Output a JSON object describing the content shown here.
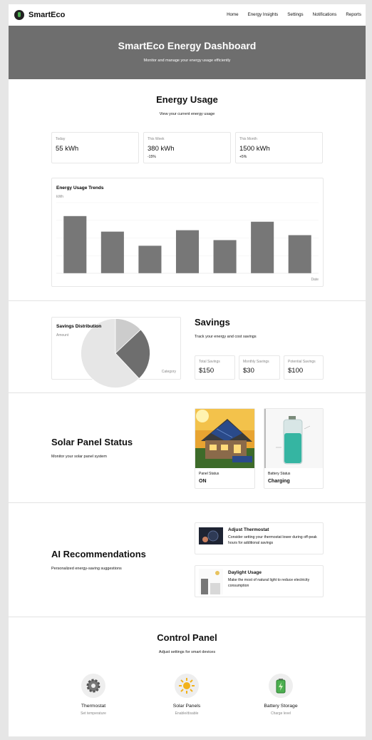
{
  "nav": {
    "brand": "SmartEco",
    "links": [
      "Home",
      "Energy Insights",
      "Settings",
      "Notifications",
      "Reports"
    ]
  },
  "hero": {
    "title": "SmartEco Energy Dashboard",
    "subtitle": "Monitor and manage your energy usage efficiently"
  },
  "usage": {
    "title": "Energy Usage",
    "subtitle": "View your current energy usage",
    "stats": [
      {
        "label": "Today",
        "value": "55 kWh",
        "change": ""
      },
      {
        "label": "This Week",
        "value": "380 kWh",
        "change": "-15%"
      },
      {
        "label": "This Month",
        "value": "1500 kWh",
        "change": "+5%"
      }
    ]
  },
  "chart_data": [
    {
      "type": "bar",
      "title": "Energy Usage Trends",
      "ylabel": "kWh",
      "xlabel": "Date",
      "ylim": [
        0,
        100
      ],
      "grid": true,
      "values": [
        81,
        59,
        39,
        61,
        47,
        73,
        54
      ]
    },
    {
      "type": "pie",
      "title": "Savings Distribution",
      "ylabel": "Amount",
      "xlabel": "Category",
      "values": [
        13,
        25,
        62
      ],
      "colors": [
        "#cccccc",
        "#6e6e6e",
        "#e6e6e6"
      ]
    }
  ],
  "savings": {
    "title": "Savings",
    "subtitle": "Track your energy and cost savings",
    "stats": [
      {
        "label": "Total Savings",
        "value": "$150"
      },
      {
        "label": "Monthly Savings",
        "value": "$30"
      },
      {
        "label": "Potential Savings",
        "value": "$100"
      }
    ]
  },
  "solar": {
    "title": "Solar Panel Status",
    "subtitle": "Monitor your solar panel system",
    "cards": [
      {
        "label": "Panel Status",
        "value": "ON",
        "image": "solar-house-photo"
      },
      {
        "label": "Battery Status",
        "value": "Charging",
        "image": "battery-illustration"
      }
    ]
  },
  "ai": {
    "title": "AI Recommendations",
    "subtitle": "Personalized energy-saving suggestions",
    "items": [
      {
        "title": "Adjust Thermostat",
        "desc": "Consider setting your thermostat lower during off-peak hours for additional savings",
        "image": "thermostat-photo"
      },
      {
        "title": "Daylight Usage",
        "desc": "Make the most of natural light to reduce electricity consumption",
        "image": "daylight-illustration"
      }
    ]
  },
  "control": {
    "title": "Control Panel",
    "subtitle": "Adjust settings for smart devices",
    "items": [
      {
        "title": "Thermostat",
        "desc": "Set temperature",
        "icon": "gear-icon"
      },
      {
        "title": "Solar Panels",
        "desc": "Enable/disable",
        "icon": "sun-icon"
      },
      {
        "title": "Battery Storage",
        "desc": "Charge level",
        "icon": "battery-icon"
      }
    ]
  }
}
